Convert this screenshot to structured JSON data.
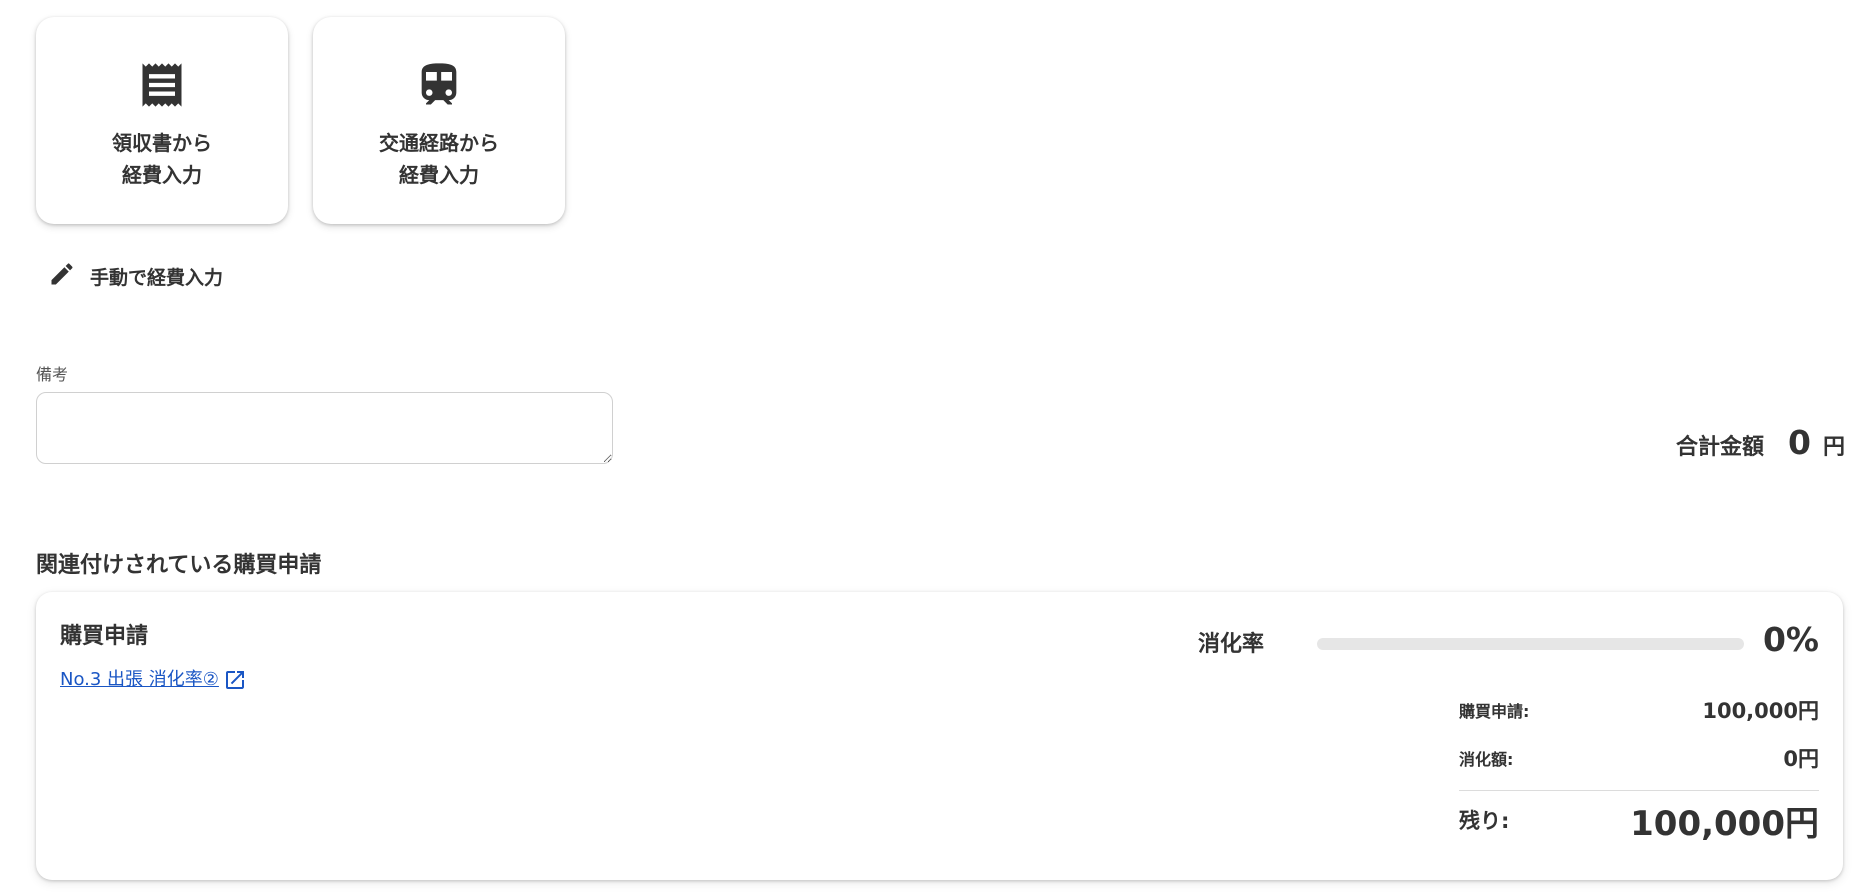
{
  "entry_cards": [
    {
      "icon": "receipt-icon",
      "line1": "領収書から",
      "line2": "経費入力"
    },
    {
      "icon": "train-icon",
      "line1": "交通経路から",
      "line2": "経費入力"
    }
  ],
  "manual_entry": {
    "icon": "pencil-icon",
    "label": "手動で経費入力"
  },
  "remarks": {
    "label": "備考",
    "value": "",
    "placeholder": ""
  },
  "total": {
    "label": "合計金額",
    "value": "0",
    "unit": "円"
  },
  "related_section": {
    "title": "関連付けされている購買申請"
  },
  "purchase_request": {
    "title": "購買申請",
    "link_text": "No.3 出張 消化率②",
    "link_icon": "external-link-icon",
    "consumption_rate_label": "消化率",
    "consumption_rate_value": "0%",
    "consumption_rate_fraction": 0,
    "breakdown": {
      "request_label": "購買申請:",
      "request_value": "100,000円",
      "consumed_label": "消化額:",
      "consumed_value": "0円",
      "remaining_label": "残り:",
      "remaining_value": "100,000円"
    }
  },
  "colors": {
    "link": "#1a56c4",
    "text": "#333333",
    "bar_track": "#e6e6e6",
    "bar_fill": "#2a7de1"
  }
}
